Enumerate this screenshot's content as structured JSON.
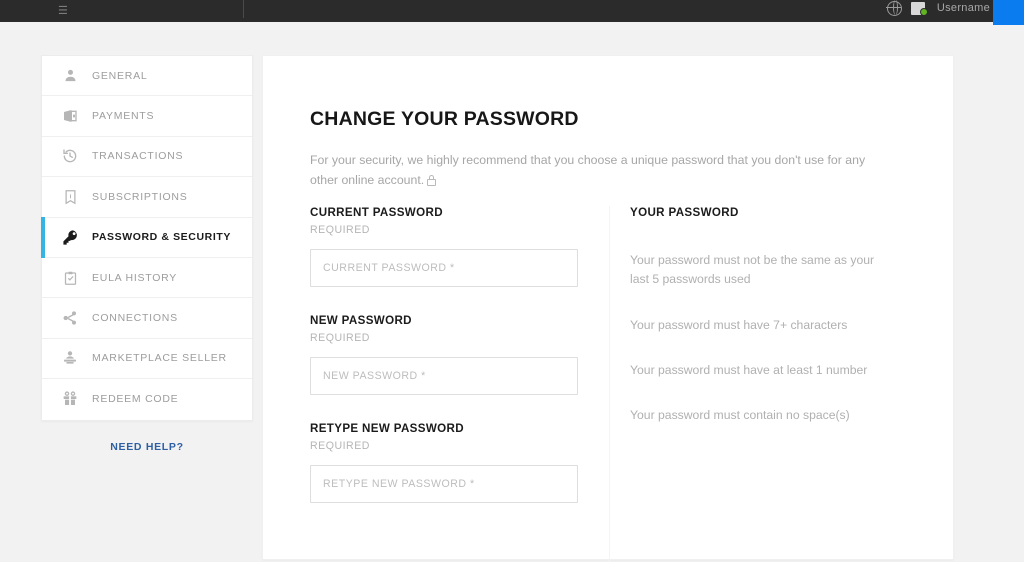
{
  "topbar": {
    "username": "Username",
    "globe_icon": "globe-icon",
    "avatar_icon": "avatar",
    "status_icon": "online-status-dot"
  },
  "sidebar": {
    "items": [
      {
        "label": "GENERAL",
        "icon": "user-icon",
        "active": false
      },
      {
        "label": "PAYMENTS",
        "icon": "wallet-icon",
        "active": false
      },
      {
        "label": "TRANSACTIONS",
        "icon": "history-icon",
        "active": false
      },
      {
        "label": "SUBSCRIPTIONS",
        "icon": "receipt-icon",
        "active": false
      },
      {
        "label": "PASSWORD & SECURITY",
        "icon": "key-icon",
        "active": true
      },
      {
        "label": "EULA HISTORY",
        "icon": "clipboard-check-icon",
        "active": false
      },
      {
        "label": "CONNECTIONS",
        "icon": "share-icon",
        "active": false
      },
      {
        "label": "MARKETPLACE SELLER",
        "icon": "seller-icon",
        "active": false
      },
      {
        "label": "REDEEM CODE",
        "icon": "gift-icon",
        "active": false
      }
    ],
    "need_help_label": "NEED HELP?"
  },
  "main": {
    "title": "CHANGE YOUR PASSWORD",
    "description": "For your security, we highly recommend that you choose a unique password that you don't use for any other online account.",
    "description_icon": "lock-icon",
    "fields": [
      {
        "label": "CURRENT PASSWORD",
        "required_text": "REQUIRED",
        "placeholder": "CURRENT PASSWORD *",
        "value": ""
      },
      {
        "label": "NEW PASSWORD",
        "required_text": "REQUIRED",
        "placeholder": "NEW PASSWORD *",
        "value": ""
      },
      {
        "label": "RETYPE NEW PASSWORD",
        "required_text": "REQUIRED",
        "placeholder": "RETYPE NEW PASSWORD *",
        "value": ""
      }
    ],
    "requirements": {
      "title": "YOUR PASSWORD",
      "items": [
        "Your password must not be the same as your last 5 passwords used",
        "Your password must have 7+ characters",
        "Your password must have at least 1 number",
        "Your password must contain no space(s)"
      ]
    }
  },
  "colors": {
    "accent_blue": "#35b3e3",
    "link_blue": "#2d5fa4",
    "tab_blue": "#0a7cf0",
    "topbar_dark": "#2b2b2b",
    "page_bg": "#f2f2f2",
    "status_green": "#61b522"
  }
}
